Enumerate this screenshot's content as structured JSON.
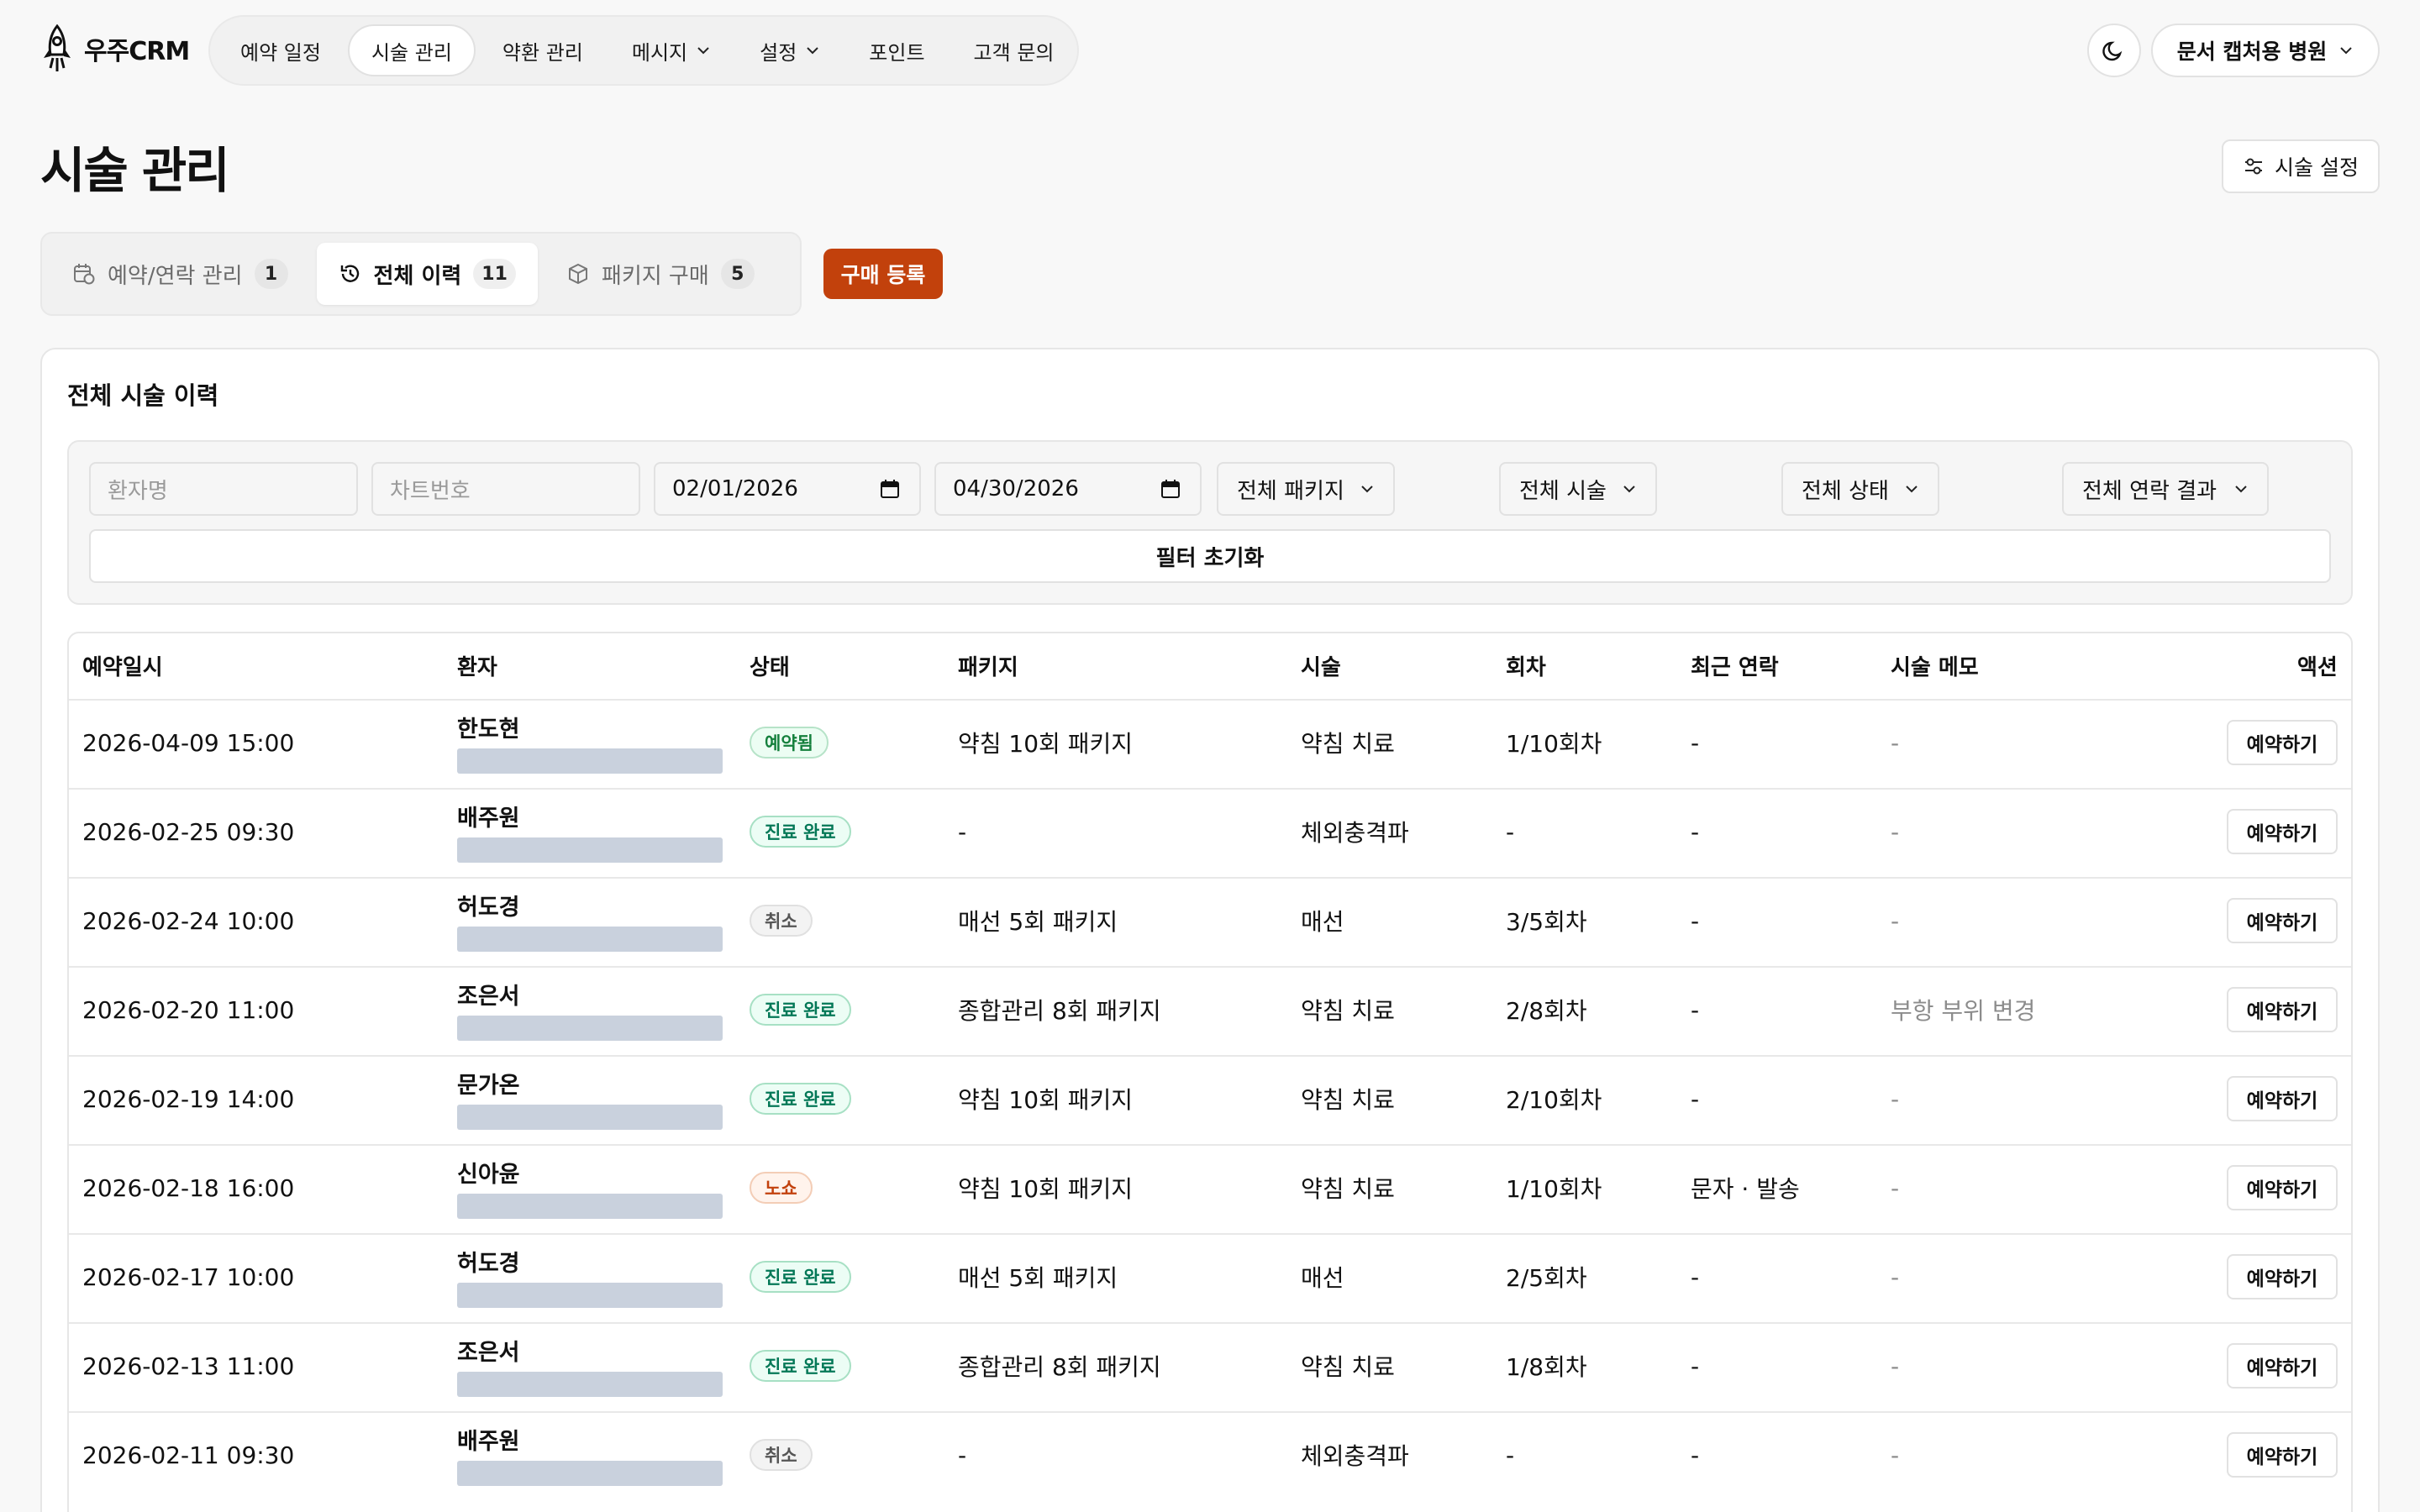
{
  "app": {
    "logo_text": "우주CRM"
  },
  "nav": {
    "items": [
      {
        "label": "예약 일정",
        "active": false,
        "dropdown": false
      },
      {
        "label": "시술 관리",
        "active": true,
        "dropdown": false
      },
      {
        "label": "약환 관리",
        "active": false,
        "dropdown": false
      },
      {
        "label": "메시지",
        "active": false,
        "dropdown": true
      },
      {
        "label": "설정",
        "active": false,
        "dropdown": true
      },
      {
        "label": "포인트",
        "active": false,
        "dropdown": false
      },
      {
        "label": "고객 문의",
        "active": false,
        "dropdown": false
      }
    ],
    "theme_icon": "moon-icon",
    "clinic_label": "문서 캡처용 병원"
  },
  "page": {
    "title": "시술 관리",
    "settings_label": "시술 설정"
  },
  "tabs": [
    {
      "label": "예약/연락 관리",
      "count": "1",
      "icon": "calendar-clock-icon",
      "active": false
    },
    {
      "label": "전체 이력",
      "count": "11",
      "icon": "history-icon",
      "active": true
    },
    {
      "label": "패키지 구매",
      "count": "5",
      "icon": "package-icon",
      "active": false
    }
  ],
  "buy_button": "구매 등록",
  "card": {
    "title": "전체 시술 이력"
  },
  "filters": {
    "patient_placeholder": "환자명",
    "chart_placeholder": "차트번호",
    "date_from": "02/01/2026",
    "date_to": "04/30/2026",
    "package_select": "전체 패키지",
    "treatment_select": "전체 시술",
    "status_select": "전체 상태",
    "contact_select": "전체 연락 결과",
    "reset_label": "필터 초기화"
  },
  "table": {
    "headers": {
      "datetime": "예약일시",
      "patient": "환자",
      "status": "상태",
      "package": "패키지",
      "treatment": "시술",
      "session": "회차",
      "contact": "최근 연락",
      "memo": "시술 메모",
      "action": "액션"
    },
    "rows": [
      {
        "datetime": "2026-04-09 15:00",
        "patient": "한도현",
        "status": "예약됨",
        "status_type": "reserved",
        "package": "약침 10회 패키지",
        "treatment": "약침 치료",
        "session": "1/10회차",
        "contact": "-",
        "memo": "-",
        "action": "예약하기"
      },
      {
        "datetime": "2026-02-25 09:30",
        "patient": "배주원",
        "status": "진료 완료",
        "status_type": "done",
        "package": "-",
        "treatment": "체외충격파",
        "session": "-",
        "contact": "-",
        "memo": "-",
        "action": "예약하기"
      },
      {
        "datetime": "2026-02-24 10:00",
        "patient": "허도경",
        "status": "취소",
        "status_type": "cancel",
        "package": "매선 5회 패키지",
        "treatment": "매선",
        "session": "3/5회차",
        "contact": "-",
        "memo": "-",
        "action": "예약하기"
      },
      {
        "datetime": "2026-02-20 11:00",
        "patient": "조은서",
        "status": "진료 완료",
        "status_type": "done",
        "package": "종합관리 8회 패키지",
        "treatment": "약침 치료",
        "session": "2/8회차",
        "contact": "-",
        "memo": "부항 부위 변경",
        "action": "예약하기"
      },
      {
        "datetime": "2026-02-19 14:00",
        "patient": "문가온",
        "status": "진료 완료",
        "status_type": "done",
        "package": "약침 10회 패키지",
        "treatment": "약침 치료",
        "session": "2/10회차",
        "contact": "-",
        "memo": "-",
        "action": "예약하기"
      },
      {
        "datetime": "2026-02-18 16:00",
        "patient": "신아윤",
        "status": "노쇼",
        "status_type": "noshow",
        "package": "약침 10회 패키지",
        "treatment": "약침 치료",
        "session": "1/10회차",
        "contact": "문자 · 발송",
        "memo": "-",
        "action": "예약하기"
      },
      {
        "datetime": "2026-02-17 10:00",
        "patient": "허도경",
        "status": "진료 완료",
        "status_type": "done",
        "package": "매선 5회 패키지",
        "treatment": "매선",
        "session": "2/5회차",
        "contact": "-",
        "memo": "-",
        "action": "예약하기"
      },
      {
        "datetime": "2026-02-13 11:00",
        "patient": "조은서",
        "status": "진료 완료",
        "status_type": "done",
        "package": "종합관리 8회 패키지",
        "treatment": "약침 치료",
        "session": "1/8회차",
        "contact": "-",
        "memo": "-",
        "action": "예약하기"
      },
      {
        "datetime": "2026-02-11 09:30",
        "patient": "배주원",
        "status": "취소",
        "status_type": "cancel",
        "package": "-",
        "treatment": "체외충격파",
        "session": "-",
        "contact": "-",
        "memo": "-",
        "action": "예약하기"
      }
    ]
  },
  "colors": {
    "accent": "#c2410c",
    "background": "#f8f8f8",
    "redacted_bar": "#c9d1dd"
  }
}
